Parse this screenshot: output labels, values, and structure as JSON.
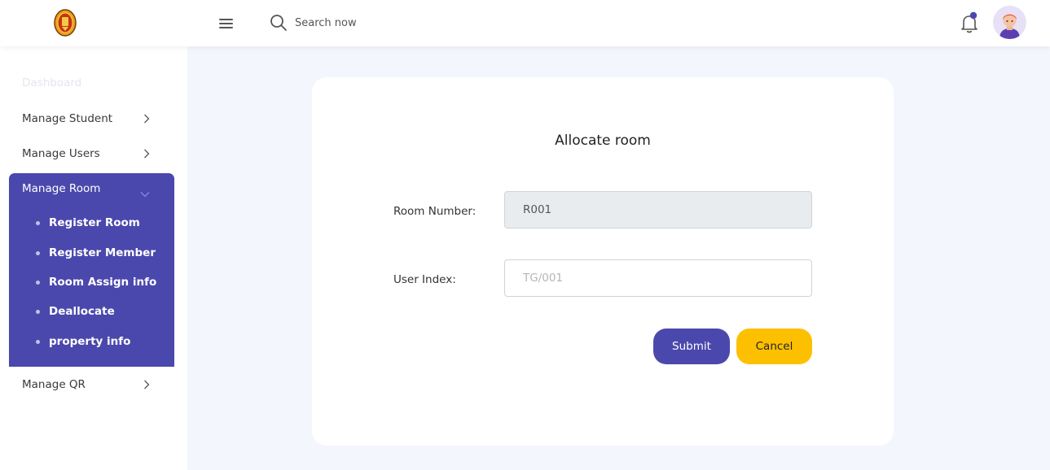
{
  "header": {
    "search_placeholder": "Search now"
  },
  "sidebar": {
    "dashboard": "Dashboard",
    "manage_student": "Manage Student",
    "manage_users": "Manage Users",
    "manage_room": "Manage Room",
    "room_subitems": [
      "Register Room",
      "Register Member",
      "Room Assign info",
      "Deallocate",
      "property info"
    ],
    "manage_qr": "Manage QR"
  },
  "form": {
    "title": "Allocate room",
    "room_number_label": "Room Number:",
    "room_number_value": "R001",
    "user_index_label": "User Index:",
    "user_index_placeholder": "TG/001",
    "submit_label": "Submit",
    "cancel_label": "Cancel"
  },
  "colors": {
    "accent": "#4b48ad",
    "warning": "#fdc000",
    "page_bg": "#f4f6fd"
  },
  "icons": [
    "logo-emblem",
    "hamburger-menu-icon",
    "search-icon",
    "bell-icon",
    "chevron-right-icon",
    "chevron-down-icon",
    "avatar"
  ]
}
